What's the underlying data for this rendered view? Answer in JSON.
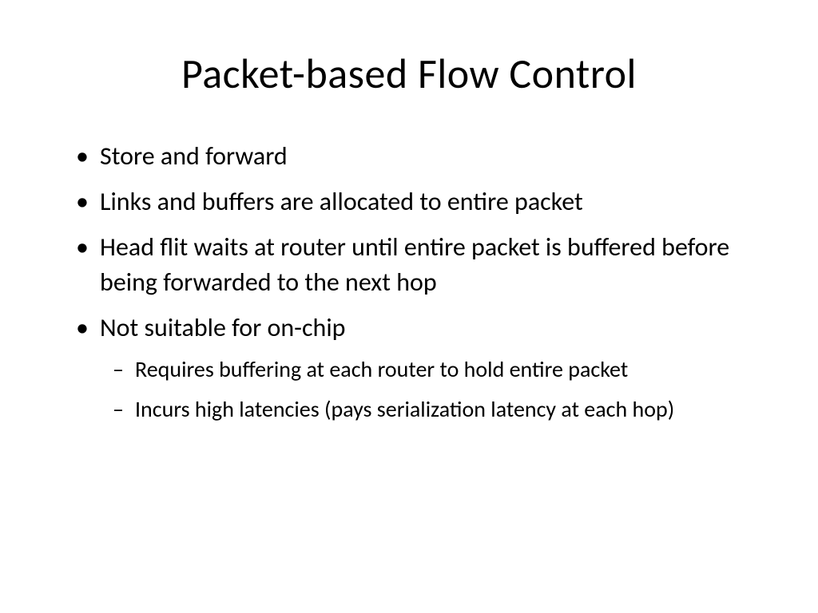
{
  "slide": {
    "title": "Packet-based Flow Control",
    "bullets": [
      {
        "text": "Store and forward"
      },
      {
        "text": "Links and buffers are allocated to entire packet"
      },
      {
        "text": "Head flit waits at router until entire packet is buffered before being forwarded to the next hop"
      },
      {
        "text": "Not suitable for on-chip",
        "children": [
          {
            "text": "Requires buffering at each router to hold entire packet"
          },
          {
            "text": "Incurs high latencies (pays serialization latency at each hop)"
          }
        ]
      }
    ]
  }
}
